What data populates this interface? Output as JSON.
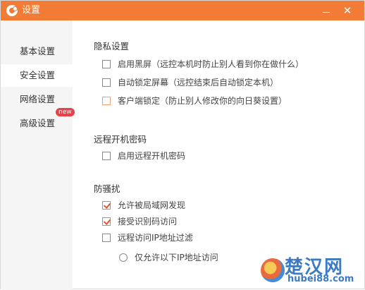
{
  "window": {
    "title": "设置"
  },
  "sidebar": {
    "items": [
      {
        "label": "基本设置"
      },
      {
        "label": "安全设置"
      },
      {
        "label": "网络设置"
      },
      {
        "label": "高级设置",
        "badge": "new"
      }
    ]
  },
  "sections": {
    "privacy": {
      "title": "隐私设置",
      "options": [
        {
          "label": "启用黑屏（远控本机时防止别人看到你在做什么）",
          "checked": false
        },
        {
          "label": "自动锁定屏幕（远控结束后自动锁定本机）",
          "checked": false
        },
        {
          "label": "客户端锁定（防止别人修改你的向日葵设置）",
          "checked": false
        }
      ]
    },
    "remote_boot": {
      "title": "远程开机密码",
      "options": [
        {
          "label": "启用远程开机密码",
          "checked": false
        }
      ]
    },
    "harassment": {
      "title": "防骚扰",
      "options": [
        {
          "label": "允许被局域网发现",
          "checked": true
        },
        {
          "label": "接受识别码访问",
          "checked": true
        },
        {
          "label": "远程访问IP地址过滤",
          "checked": false
        }
      ],
      "radio": {
        "label": "仅允许以下IP地址访问",
        "selected": false
      }
    }
  },
  "watermark": {
    "text": "楚汉网",
    "url": "hubei88.com"
  },
  "colors": {
    "titlebar": "#f27b35",
    "check": "#e8542c",
    "badge": "#e8414a",
    "sidebar": "#f5f5f5"
  }
}
